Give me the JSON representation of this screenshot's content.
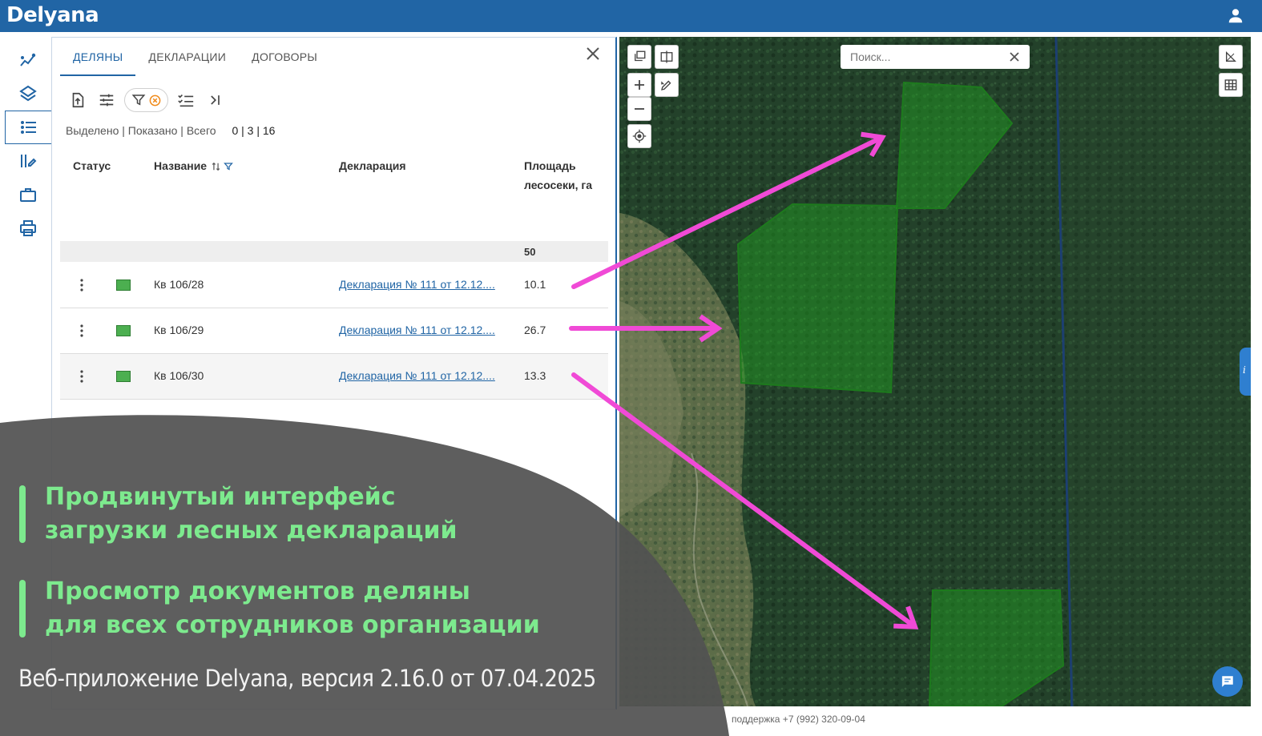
{
  "app": {
    "logo": "Delyana"
  },
  "tabs": [
    {
      "label": "ДЕЛЯНЫ",
      "active": true
    },
    {
      "label": "ДЕКЛАРАЦИИ",
      "active": false
    },
    {
      "label": "ДОГОВОРЫ",
      "active": false
    }
  ],
  "rail": {
    "items": [
      {
        "icon": "analytics-icon"
      },
      {
        "icon": "layers-icon"
      },
      {
        "icon": "list-icon",
        "active": true
      },
      {
        "icon": "sort-edit-icon"
      },
      {
        "icon": "briefcase-icon"
      },
      {
        "icon": "print-icon"
      }
    ]
  },
  "toolbar": {
    "icons": [
      "upload-icon",
      "sliders-icon",
      "filter-icon",
      "clear-filter-icon",
      "checklist-icon",
      "collapse-icon"
    ]
  },
  "counts": {
    "label": "Выделено | Показано | Всего",
    "values": "0 | 3 | 16"
  },
  "table": {
    "headers": {
      "status": "Статус",
      "name": "Название",
      "declaration": "Декларация",
      "area_line1": "Площадь",
      "area_line2": "лесосеки, га"
    },
    "total_area": "50",
    "rows": [
      {
        "name": "Кв 106/28",
        "declaration": "Декларация № 111 от 12.12....",
        "area": "10.1"
      },
      {
        "name": "Кв 106/29",
        "declaration": "Декларация № 111 от 12.12....",
        "area": "26.7"
      },
      {
        "name": "Кв 106/30",
        "declaration": "Декларация № 111 от 12.12....",
        "area": "13.3"
      }
    ]
  },
  "map": {
    "search_placeholder": "Поиск...",
    "side_tab_label": "i"
  },
  "footer": {
    "support": "поддержка +7 (992) 320-09-04"
  },
  "promo": {
    "line1": "Продвинутый интерфейс",
    "line2": "загрузки лесных деклараций",
    "line3": "Просмотр документов деляны",
    "line4": "для всех сотрудников организации",
    "version": "Веб-приложение Delyana, версия 2.16.0 от 07.04.2025"
  },
  "colors": {
    "brand": "#2165a5",
    "polygon": "#1f8a1f",
    "arrow": "#f04ad6",
    "promo_text": "#7dea8e",
    "overlay": "#505050"
  }
}
